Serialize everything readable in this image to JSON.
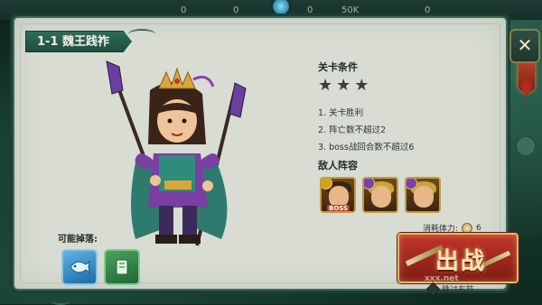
{
  "topbar": {
    "values": [
      "0",
      "0",
      "0",
      "50K",
      "0"
    ]
  },
  "level": {
    "title": "1-1 魏王践祚"
  },
  "conditions": {
    "title": "关卡条件",
    "stars": 3,
    "items": [
      "1. 关卡胜利",
      "2. 阵亡数不超过2",
      "3. boss战回合数不超过6"
    ]
  },
  "enemies": {
    "title": "敌人阵容",
    "boss_tag": "BOSS"
  },
  "drops": {
    "title": "可能掉落:"
  },
  "stamina": {
    "label": "消耗体力:",
    "value": "6"
  },
  "battle": {
    "label": "出战"
  },
  "skip": {
    "label": "跳过布阵"
  },
  "close": {
    "label": "✕"
  },
  "watermark": {
    "text": "xxx.net"
  },
  "colors": {
    "panel_bg": "#d8dcd2",
    "frame": "#3c6b5c",
    "battle_red": "#c2362a",
    "gold": "#e2b866"
  }
}
